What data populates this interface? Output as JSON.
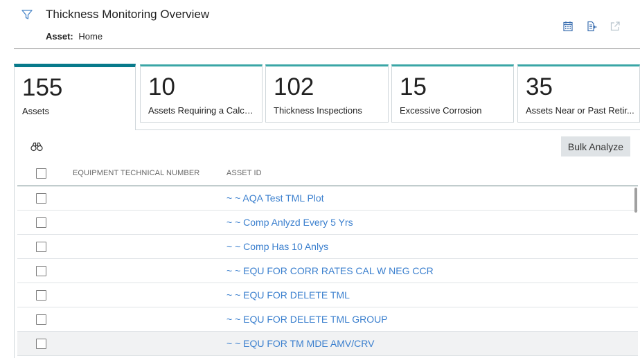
{
  "header": {
    "title": "Thickness Monitoring Overview",
    "asset_label": "Asset:",
    "asset_value": "Home",
    "icons": [
      "filter-icon",
      "calendar-icon",
      "import-icon",
      "external-link-icon"
    ]
  },
  "tiles": [
    {
      "count": "155",
      "label": "Assets",
      "active": true
    },
    {
      "count": "10",
      "label": "Assets Requiring a Calcul...",
      "active": false
    },
    {
      "count": "102",
      "label": "Thickness Inspections",
      "active": false
    },
    {
      "count": "15",
      "label": "Excessive Corrosion",
      "active": false
    },
    {
      "count": "35",
      "label": "Assets Near or Past Retir...",
      "active": false
    }
  ],
  "toolbar": {
    "bulk_analyze_label": "Bulk Analyze",
    "search_icon": "binoculars-icon"
  },
  "table": {
    "columns": [
      "EQUIPMENT TECHNICAL NUMBER",
      "ASSET ID"
    ],
    "rows": [
      {
        "equipment": "",
        "asset_id": "~ ~ AQA Test TML Plot"
      },
      {
        "equipment": "",
        "asset_id": "~ ~ Comp Anlyzd Every 5 Yrs"
      },
      {
        "equipment": "",
        "asset_id": "~ ~ Comp Has 10 Anlys"
      },
      {
        "equipment": "",
        "asset_id": "~ ~ EQU FOR CORR RATES CAL W NEG CCR"
      },
      {
        "equipment": "",
        "asset_id": "~ ~ EQU FOR DELETE TML"
      },
      {
        "equipment": "",
        "asset_id": "~ ~ EQU FOR DELETE TML GROUP"
      },
      {
        "equipment": "",
        "asset_id": "~ ~ EQU FOR TM MDE AMV/CRV"
      }
    ]
  },
  "colors": {
    "accent": "#087a8b",
    "tile_border_top": "#3aa6a6",
    "link": "#3a7fce",
    "button_bg": "#dfe3e6"
  }
}
